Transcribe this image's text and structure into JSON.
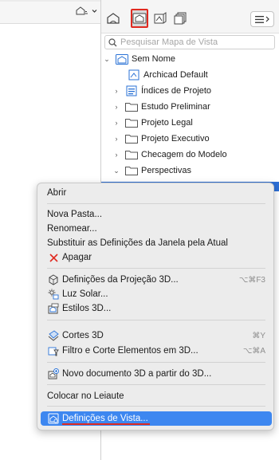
{
  "search": {
    "placeholder": "Pesquisar Mapa de Vista"
  },
  "tree": [
    {
      "label": "Sem Nome",
      "chevron": "⌄",
      "icon": "project-view-icon"
    },
    {
      "label": "Archicad Default",
      "chevron": "",
      "icon": "view-settings-icon"
    },
    {
      "label": "Índices de Projeto",
      "chevron": "›",
      "icon": "index-icon"
    },
    {
      "label": "Estudo Preliminar",
      "chevron": "›",
      "icon": "folder-icon"
    },
    {
      "label": "Projeto Legal",
      "chevron": "›",
      "icon": "folder-icon"
    },
    {
      "label": "Projeto Executivo",
      "chevron": "›",
      "icon": "folder-icon"
    },
    {
      "label": "Checagem do Modelo",
      "chevron": "›",
      "icon": "folder-icon"
    },
    {
      "label": "Perspectivas",
      "chevron": "⌄",
      "icon": "folder-icon"
    }
  ],
  "menu": {
    "open": "Abrir",
    "new_folder": "Nova Pasta...",
    "rename": "Renomear...",
    "replace_settings": "Substituir as Definições da Janela pela Atual",
    "delete": "Apagar",
    "projection_3d": "Definições da Projeção 3D...",
    "projection_3d_shortcut": "⌥⌘F3",
    "sun": "Luz Solar...",
    "styles_3d": "Estilos 3D...",
    "cuts_3d": "Cortes 3D",
    "cuts_3d_shortcut": "⌘Y",
    "filter_cut": "Filtro e Corte  Elementos em 3D...",
    "filter_cut_shortcut": "⌥⌘A",
    "new_3d_doc": "Novo documento 3D a partir do 3D...",
    "place_layout": "Colocar no Leiaute",
    "view_settings": "Definições de Vista..."
  },
  "colors": {
    "accent": "#3d87f0",
    "highlight_outline": "#e02a20",
    "folder": "#555555",
    "icon_blue": "#2a72d6"
  }
}
